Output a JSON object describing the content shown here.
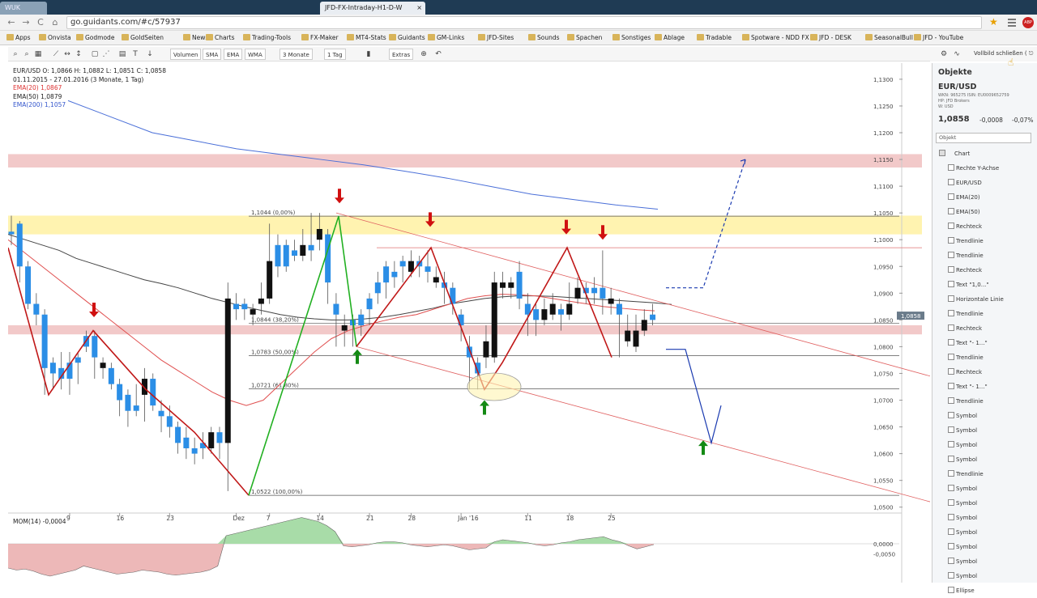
{
  "browser": {
    "tabs": [
      {
        "label": "WUK"
      },
      {
        "label": "JFD-FX-Intraday-H1-D-W",
        "close": "×"
      }
    ],
    "url": "go.guidants.com/#c/57937",
    "nav": {
      "back": "←",
      "forward": "→",
      "reload": "C",
      "home": "⌂"
    },
    "abp": "ABP",
    "bookmarks": [
      "Apps",
      "Onvista",
      "Godmode",
      "GoldSeiten",
      "News",
      "Charts",
      "Trading-Tools",
      "FX-Maker",
      "MT4-Stats",
      "Guidants",
      "GM-Links",
      "JFD-Sites",
      "Sounds",
      "Spachen",
      "Sonstiges",
      "Ablage",
      "Tradable",
      "Spotware - NDD FX ...",
      "JFD - DESK",
      "SeasonalBull",
      "JFD - YouTube"
    ]
  },
  "toolbar": {
    "volumen": "Volumen",
    "sma": "SMA",
    "ema": "EMA",
    "wma": "WMA",
    "period": "3 Monate",
    "interval": "1 Tag",
    "extras": "Extras",
    "fullscreen": "Vollbild schließen ( ⎋"
  },
  "chart_info": {
    "ohlc": "EUR/USD  O: 1,0866  H: 1,0882  L: 1,0851  C: 1,0858",
    "range": "01.11.2015 - 27.01.2016 (3 Monate, 1 Tag)",
    "ema20": "EMA(20)  1,0867",
    "ema50": "EMA(50)  1,0879",
    "ema200": "EMA(200)  1,1057",
    "mom": "MOM(14)  -0,0004",
    "current_price_label": "1,0858",
    "colors": {
      "bull": "#2b8ee6",
      "bear": "#111111",
      "ema20": "#e05050",
      "ema50": "#444444",
      "ema200": "#4a6fd8",
      "zigzag_red": "#c01818",
      "zigzag_green": "#22b022",
      "forecast": "#1a3ab0"
    }
  },
  "chart_data": {
    "type": "candlestick",
    "symbol": "EUR/USD",
    "y_ticks": [
      "1,1300",
      "1,1250",
      "1,1200",
      "1,1150",
      "1,1100",
      "1,1050",
      "1,1000",
      "1,0950",
      "1,0900",
      "1,0850",
      "1,0800",
      "1,0750",
      "1,0700",
      "1,0650",
      "1,0600",
      "1,0550",
      "1,0500"
    ],
    "ylim": [
      1.0495,
      1.1315
    ],
    "x_ticks": [
      "9",
      "16",
      "23",
      "Dez",
      "7",
      "14",
      "21",
      "28",
      "Jan '16",
      "11",
      "18",
      "25"
    ],
    "fib_levels": [
      {
        "label": "1,1044 (0,00%)",
        "price": 1.1044
      },
      {
        "label": "1,0844 (38,20%)",
        "price": 1.0844
      },
      {
        "label": "1,0783 (50,00%)",
        "price": 1.0783
      },
      {
        "label": "1,0721 (61,80%)",
        "price": 1.0721
      },
      {
        "label": "1,0522 (100,00%)",
        "price": 1.0522
      }
    ],
    "zones": [
      {
        "low": 1.1135,
        "high": 1.116,
        "color": "#f2c9c9"
      },
      {
        "low": 1.101,
        "high": 1.1045,
        "color": "#fff3b0"
      },
      {
        "low": 1.0823,
        "high": 1.084,
        "color": "#f2c9c9"
      }
    ],
    "candles": [
      [
        1.101,
        1.1045,
        1.1015,
        1.099
      ],
      [
        1.095,
        1.1035,
        1.103,
        1.092
      ],
      [
        1.088,
        1.096,
        1.095,
        1.087
      ],
      [
        1.086,
        1.09,
        1.088,
        1.084
      ],
      [
        1.076,
        1.087,
        1.086,
        1.071
      ],
      [
        1.075,
        1.078,
        1.077,
        1.072
      ],
      [
        1.074,
        1.079,
        1.076,
        1.072
      ],
      [
        1.074,
        1.079,
        1.077,
        1.071
      ],
      [
        1.077,
        1.079,
        1.078,
        1.073
      ],
      [
        1.08,
        1.083,
        1.082,
        1.079
      ],
      [
        1.078,
        1.083,
        1.082,
        1.074
      ],
      [
        1.077,
        1.078,
        1.076,
        1.074
      ],
      [
        1.073,
        1.077,
        1.076,
        1.072
      ],
      [
        1.07,
        1.074,
        1.073,
        1.067
      ],
      [
        1.068,
        1.072,
        1.071,
        1.065
      ],
      [
        1.068,
        1.073,
        1.069,
        1.067
      ],
      [
        1.074,
        1.076,
        1.071,
        1.066
      ],
      [
        1.069,
        1.075,
        1.074,
        1.068
      ],
      [
        1.067,
        1.07,
        1.068,
        1.064
      ],
      [
        1.065,
        1.069,
        1.067,
        1.063
      ],
      [
        1.062,
        1.066,
        1.065,
        1.06
      ],
      [
        1.061,
        1.065,
        1.063,
        1.059
      ],
      [
        1.06,
        1.063,
        1.061,
        1.058
      ],
      [
        1.061,
        1.064,
        1.062,
        1.059
      ],
      [
        1.064,
        1.065,
        1.061,
        1.06
      ],
      [
        1.062,
        1.065,
        1.064,
        1.059
      ],
      [
        1.089,
        1.092,
        1.062,
        1.053
      ],
      [
        1.087,
        1.09,
        1.088,
        1.085
      ],
      [
        1.087,
        1.089,
        1.088,
        1.085
      ],
      [
        1.087,
        1.088,
        1.086,
        1.084
      ],
      [
        1.089,
        1.092,
        1.088,
        1.086
      ],
      [
        1.096,
        1.103,
        1.089,
        1.088
      ],
      [
        1.095,
        1.101,
        1.099,
        1.093
      ],
      [
        1.095,
        1.1,
        1.099,
        1.094
      ],
      [
        1.097,
        1.1,
        1.098,
        1.096
      ],
      [
        1.099,
        1.102,
        1.097,
        1.096
      ],
      [
        1.098,
        1.105,
        1.099,
        1.096
      ],
      [
        1.102,
        1.105,
        1.1,
        1.098
      ],
      [
        1.092,
        1.102,
        1.101,
        1.088
      ],
      [
        1.086,
        1.09,
        1.088,
        1.08
      ],
      [
        1.084,
        1.086,
        1.083,
        1.08
      ],
      [
        1.084,
        1.086,
        1.085,
        1.08
      ],
      [
        1.084,
        1.087,
        1.086,
        1.082
      ],
      [
        1.087,
        1.09,
        1.089,
        1.084
      ],
      [
        1.09,
        1.094,
        1.092,
        1.088
      ],
      [
        1.092,
        1.096,
        1.095,
        1.089
      ],
      [
        1.093,
        1.096,
        1.094,
        1.091
      ],
      [
        1.095,
        1.097,
        1.096,
        1.092
      ],
      [
        1.096,
        1.098,
        1.094,
        1.093
      ],
      [
        1.095,
        1.097,
        1.096,
        1.093
      ],
      [
        1.094,
        1.098,
        1.095,
        1.092
      ],
      [
        1.093,
        1.095,
        1.092,
        1.091
      ],
      [
        1.091,
        1.094,
        1.092,
        1.088
      ],
      [
        1.088,
        1.092,
        1.091,
        1.086
      ],
      [
        1.084,
        1.087,
        1.086,
        1.081
      ],
      [
        1.078,
        1.082,
        1.08,
        1.072
      ],
      [
        1.075,
        1.078,
        1.077,
        1.072
      ],
      [
        1.081,
        1.084,
        1.078,
        1.076
      ],
      [
        1.092,
        1.094,
        1.078,
        1.077
      ],
      [
        1.092,
        1.094,
        1.091,
        1.089
      ],
      [
        1.092,
        1.093,
        1.091,
        1.089
      ],
      [
        1.089,
        1.096,
        1.094,
        1.087
      ],
      [
        1.086,
        1.09,
        1.088,
        1.082
      ],
      [
        1.085,
        1.088,
        1.087,
        1.082
      ],
      [
        1.087,
        1.089,
        1.085,
        1.084
      ],
      [
        1.088,
        1.09,
        1.086,
        1.085
      ],
      [
        1.086,
        1.088,
        1.087,
        1.083
      ],
      [
        1.088,
        1.092,
        1.086,
        1.085
      ],
      [
        1.091,
        1.093,
        1.089,
        1.088
      ],
      [
        1.09,
        1.092,
        1.091,
        1.088
      ],
      [
        1.09,
        1.093,
        1.091,
        1.088
      ],
      [
        1.089,
        1.098,
        1.091,
        1.086
      ],
      [
        1.089,
        1.091,
        1.088,
        1.086
      ],
      [
        1.086,
        1.089,
        1.088,
        1.078
      ],
      [
        1.083,
        1.086,
        1.081,
        1.08
      ],
      [
        1.083,
        1.086,
        1.08,
        1.079
      ],
      [
        1.085,
        1.087,
        1.083,
        1.082
      ],
      [
        1.085,
        1.088,
        1.086,
        1.084
      ]
    ],
    "mom": [
      -0.012,
      -0.013,
      -0.0125,
      -0.0135,
      -0.015,
      -0.016,
      -0.015,
      -0.014,
      -0.013,
      -0.011,
      -0.012,
      -0.013,
      -0.014,
      -0.015,
      -0.0145,
      -0.014,
      -0.013,
      -0.0135,
      -0.014,
      -0.015,
      -0.0155,
      -0.015,
      -0.0145,
      -0.014,
      -0.013,
      -0.011,
      0.004,
      0.005,
      0.006,
      0.007,
      0.008,
      0.009,
      0.01,
      0.011,
      0.012,
      0.013,
      0.012,
      0.011,
      0.009,
      0.006,
      -0.001,
      -0.0015,
      -0.001,
      -0.0005,
      0.0005,
      0.001,
      0.001,
      0.0005,
      -0.0005,
      -0.001,
      -0.0015,
      -0.001,
      -0.0005,
      -0.001,
      -0.002,
      -0.003,
      -0.0025,
      -0.002,
      0.001,
      0.002,
      0.0015,
      0.001,
      0.0005,
      -0.0005,
      -0.001,
      -0.0005,
      0.0005,
      0.001,
      0.002,
      0.0025,
      0.003,
      0.0035,
      0.002,
      0.001,
      -0.001,
      -0.0025,
      -0.0015,
      -0.0004
    ],
    "mom_ticks": [
      "0,0000",
      "-0,0050"
    ],
    "ema50": [
      1.101,
      1.1,
      1.099,
      1.098,
      1.0965,
      1.0955,
      1.0945,
      1.0935,
      1.0925,
      1.0918,
      1.091,
      1.09,
      1.089,
      1.0882,
      1.0874,
      1.0867,
      1.086,
      1.0855,
      1.0852,
      1.085,
      1.085,
      1.0852,
      1.0855,
      1.086,
      1.0866,
      1.0872,
      1.088,
      1.0885,
      1.089,
      1.0893,
      1.0895,
      1.0895,
      1.0894,
      1.0892,
      1.089,
      1.0888,
      1.0886,
      1.0884,
      1.0882,
      1.0879
    ],
    "ema20": [
      1.1,
      1.0975,
      1.095,
      1.0925,
      1.09,
      1.0875,
      1.085,
      1.0825,
      1.08,
      1.0775,
      1.0755,
      1.0735,
      1.0715,
      1.07,
      1.069,
      1.07,
      1.073,
      1.076,
      1.079,
      1.0815,
      1.083,
      1.084,
      1.0848,
      1.0855,
      1.086,
      1.087,
      1.088,
      1.089,
      1.0895,
      1.0898,
      1.0897,
      1.0895,
      1.089,
      1.0885,
      1.088,
      1.0875,
      1.0872,
      1.0869,
      1.0867
    ],
    "ema200": [
      1.126,
      1.123,
      1.12,
      1.1185,
      1.117,
      1.116,
      1.115,
      1.114,
      1.1128,
      1.1115,
      1.11,
      1.1085,
      1.1075,
      1.1065,
      1.1057
    ]
  },
  "panel": {
    "title": "Objekte",
    "symbol": "EUR/USD",
    "wkn": "WKN: 965275  ISIN: EU0009652759",
    "hp": "HP: JFD Brokers",
    "w": "W: USD",
    "price": "1,0858",
    "change": "-0,0008",
    "pct": "-0,07%",
    "select": "Objekt",
    "root": "Chart",
    "items": [
      "Rechte Y-Achse",
      "EUR/USD",
      "EMA(20)",
      "EMA(50)",
      "Rechteck",
      "Trendlinie",
      "Trendlinie",
      "Rechteck",
      "Text \"1,0...\"",
      "Horizontale Linie",
      "Trendlinie",
      "Rechteck",
      "Text \"- 1...\"",
      "Trendlinie",
      "Rechteck",
      "Text \"- 1...\"",
      "Trendlinie",
      "Symbol",
      "Symbol",
      "Symbol",
      "Symbol",
      "Trendlinie",
      "Symbol",
      "Symbol",
      "Symbol",
      "Symbol",
      "Symbol",
      "Symbol",
      "Symbol",
      "Ellipse"
    ]
  }
}
